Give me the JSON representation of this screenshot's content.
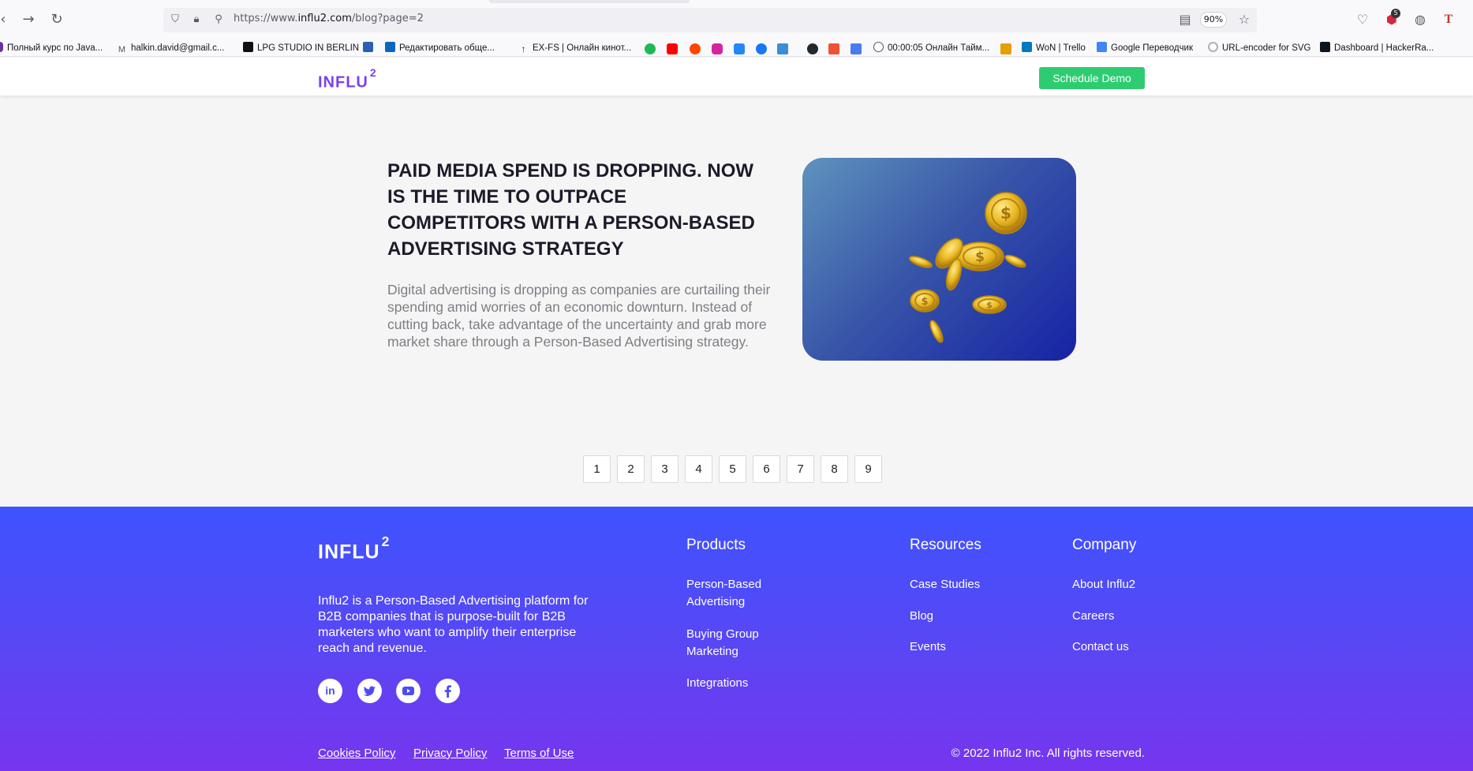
{
  "browser": {
    "url_prefix": "https://www.",
    "url_host": "influ2.com",
    "url_path": "/blog?page=2",
    "zoom": "90%",
    "extension_badge": "5",
    "bookmarks": [
      "Полный курс по Java...",
      "halkin.david@gmail.c...",
      "LPG STUDIO IN BERLIN",
      "Редактировать обще...",
      "EX-FS | Онлайн кинот...",
      "00:00:05 Онлайн Тайм...",
      "WoN | Trello",
      "Google Переводчик",
      "URL-encoder for SVG",
      "Dashboard | HackerRa..."
    ]
  },
  "header": {
    "logo_text": "INFLU",
    "logo_sup": "2",
    "demo_button": "Schedule Demo"
  },
  "article": {
    "title": "PAID MEDIA SPEND IS DROPPING. NOW IS THE TIME TO OUTPACE COMPETITORS WITH A PERSON-BASED ADVERTISING STRATEGY",
    "excerpt": "Digital advertising is dropping as companies are curtailing their spending amid worries of an economic downturn. Instead of cutting back, take advantage of the uncertainty and grab more market share through a Person-Based Advertising strategy."
  },
  "pagination": [
    "1",
    "2",
    "3",
    "4",
    "5",
    "6",
    "7",
    "8",
    "9"
  ],
  "footer": {
    "logo_text": "INFLU",
    "logo_sup": "2",
    "description": "Influ2 is a Person-Based Advertising platform for B2B companies that is purpose-built for B2B marketers who want to amplify their enterprise reach and revenue.",
    "social": [
      "linkedin-icon",
      "twitter-icon",
      "youtube-icon",
      "facebook-icon"
    ],
    "columns": {
      "products": {
        "heading": "Products",
        "links": [
          "Person-Based Advertising",
          "Buying Group Marketing",
          "Integrations"
        ]
      },
      "resources": {
        "heading": "Resources",
        "links": [
          "Case Studies",
          "Blog",
          "Events"
        ]
      },
      "company": {
        "heading": "Company",
        "links": [
          "About Influ2",
          "Careers",
          "Contact us"
        ]
      }
    },
    "legal": [
      "Cookies Policy",
      "Privacy Policy",
      "Terms of Use"
    ],
    "copyright": "© 2022 Influ2 Inc. All rights reserved."
  },
  "colors": {
    "brand_purple": "#7a3ff2",
    "demo_green": "#2ecc71",
    "footer_top": "#3e53fe",
    "footer_bottom": "#7735ef"
  }
}
